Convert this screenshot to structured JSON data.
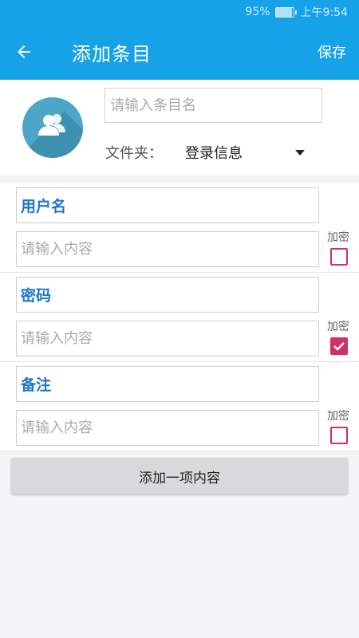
{
  "status": {
    "battery": "95%",
    "time": "上午9:54"
  },
  "header": {
    "title": "添加条目",
    "save_label": "保存"
  },
  "entry": {
    "name_placeholder": "请输入条目名",
    "folder_label": "文件夹：",
    "folder_value": "登录信息"
  },
  "fields": [
    {
      "name": "用户名",
      "value_placeholder": "请输入内容",
      "encrypt_label": "加密",
      "encrypted": false
    },
    {
      "name": "密码",
      "value_placeholder": "请输入内容",
      "encrypt_label": "加密",
      "encrypted": true
    },
    {
      "name": "备注",
      "value_placeholder": "请输入内容",
      "encrypt_label": "加密",
      "encrypted": false
    }
  ],
  "add_button_label": "添加一项内容",
  "colors": {
    "accent": "#16a2e6",
    "checkbox": "#d22e6a",
    "field_name": "#1f76c9"
  },
  "icons": {
    "back": "arrow-left-icon",
    "avatar": "users-icon",
    "dropdown": "caret-down-icon",
    "check": "check-icon"
  }
}
